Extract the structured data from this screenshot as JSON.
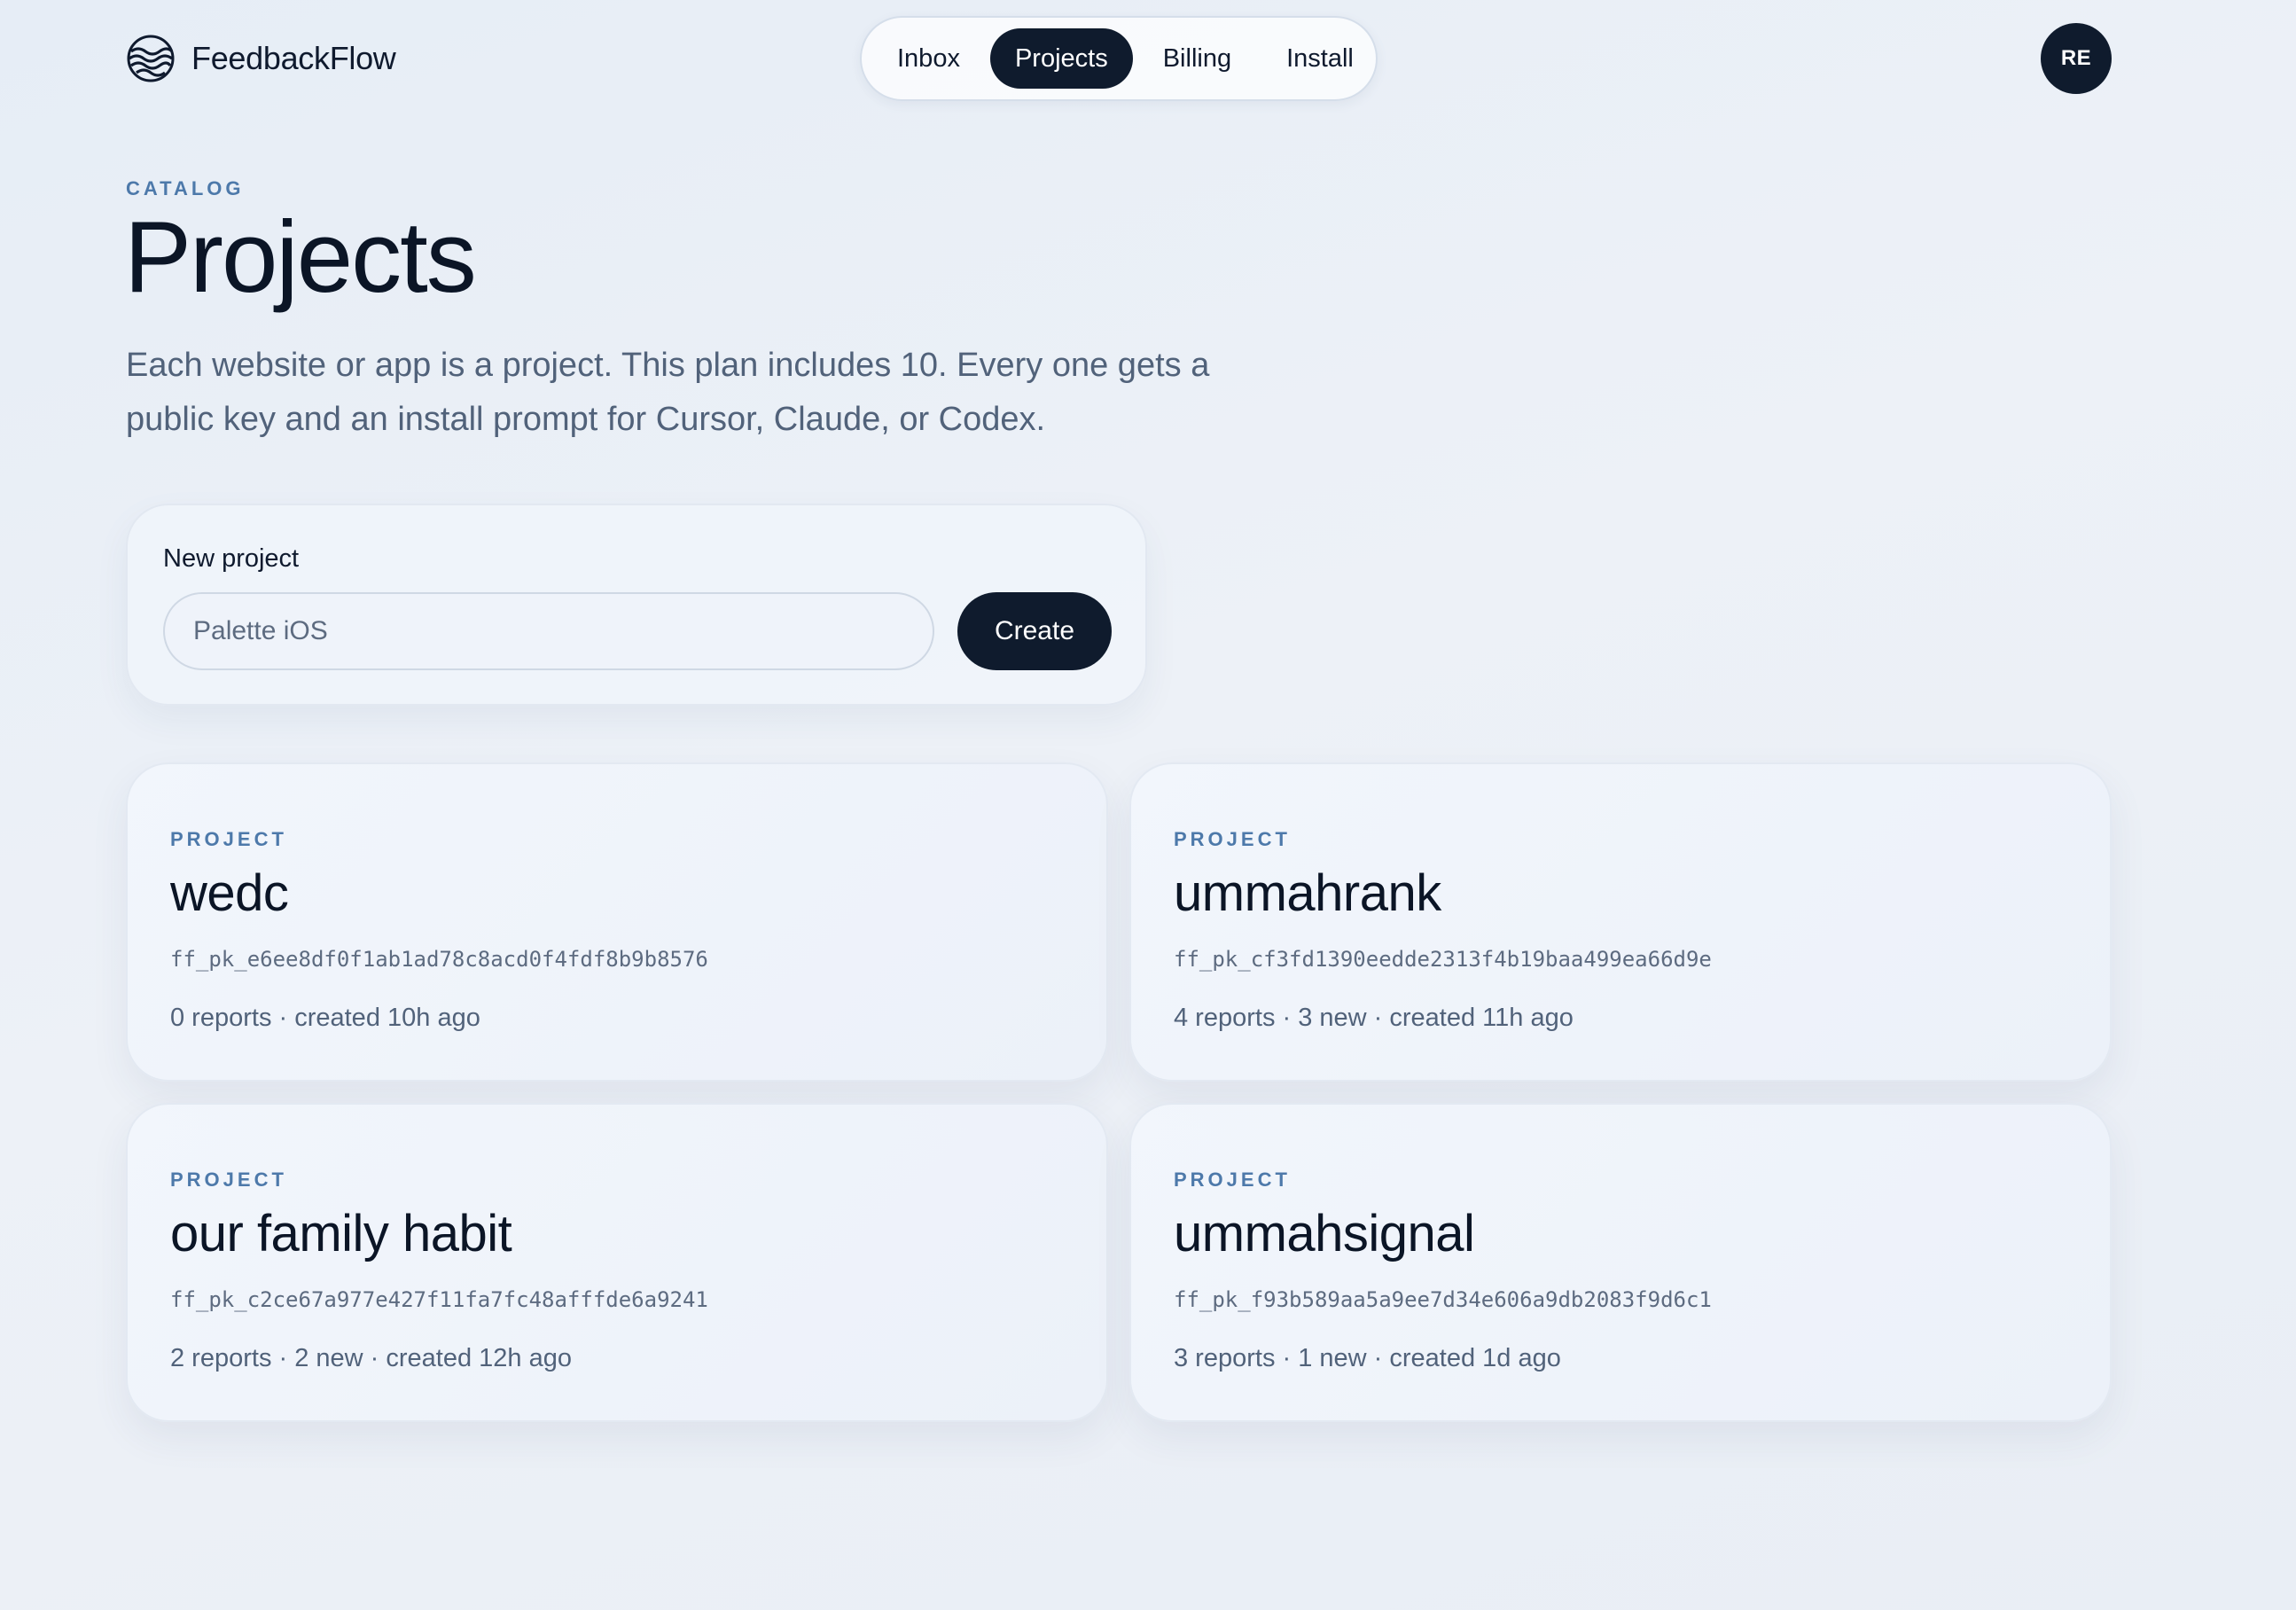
{
  "header": {
    "brand_name": "FeedbackFlow",
    "nav": [
      {
        "label": "Inbox",
        "active": false
      },
      {
        "label": "Projects",
        "active": true
      },
      {
        "label": "Billing",
        "active": false
      },
      {
        "label": "Install",
        "active": false
      }
    ],
    "avatar_initials": "RE"
  },
  "hero": {
    "eyebrow": "CATALOG",
    "title": "Projects",
    "description": "Each website or app is a project. This plan includes 10. Every one gets a public key and an install prompt for Cursor, Claude, or Codex."
  },
  "new_project": {
    "label": "New project",
    "input_value": "",
    "input_placeholder": "Palette iOS",
    "create_label": "Create"
  },
  "projects": [
    {
      "kicker": "PROJECT",
      "name": "wedc",
      "key": "ff_pk_e6ee8df0f1ab1ad78c8acd0f4fdf8b9b8576",
      "meta": "0 reports · created 10h ago"
    },
    {
      "kicker": "PROJECT",
      "name": "ummahrank",
      "key": "ff_pk_cf3fd1390eedde2313f4b19baa499ea66d9e",
      "meta": "4 reports · 3 new · created 11h ago"
    },
    {
      "kicker": "PROJECT",
      "name": "our family habit",
      "key": "ff_pk_c2ce67a977e427f11fa7fc48afffde6a9241",
      "meta": "2 reports · 2 new · created 12h ago"
    },
    {
      "kicker": "PROJECT",
      "name": "ummahsignal",
      "key": "ff_pk_f93b589aa5a9ee7d34e606a9db2083f9d6c1",
      "meta": "3 reports · 1 new · created 1d ago"
    }
  ],
  "colors": {
    "primary_dark": "#0f1b2d",
    "accent_eyebrow": "#4d79aa",
    "muted_text": "#51627a"
  },
  "icons": {
    "brand": "wave-globe-icon"
  }
}
